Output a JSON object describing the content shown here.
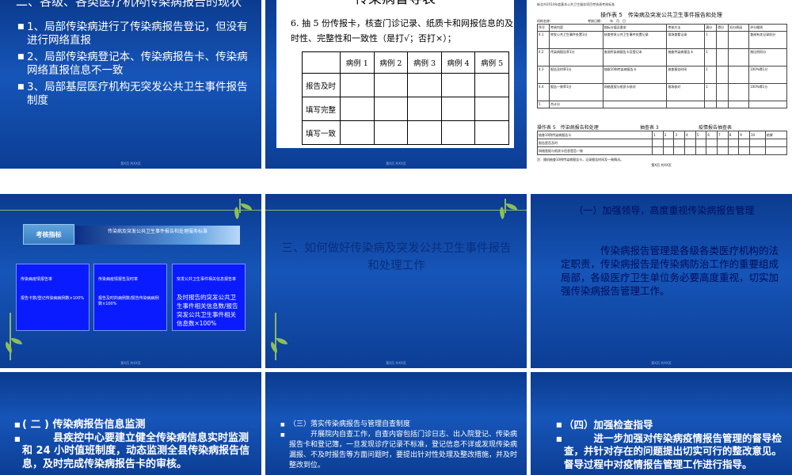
{
  "slide1": {
    "title": "二、各级、各类医疗机构传染病报告的现状",
    "bullets": [
      "1、局部传染病进行了传染病报告登记，但没有进行网络直报",
      "2、局部传染病登记本、传染病报告卡、传染病网络直报信息不一致",
      "3、局部基层医疗机构无突发公共卫生事件报告制度"
    ],
    "footer": "第X页 共XX页"
  },
  "slide2": {
    "title": "传染病督导表",
    "desc": "6. 抽 5 份传报卡，核查门诊记录、纸质卡和网报信息的及时性、完整性和一致性（是打√；否打×）；",
    "columns": [
      "",
      "病例 1",
      "病例 2",
      "病例 3",
      "病例 4",
      "病例 5"
    ],
    "rows": [
      "报告及时",
      "填写完整",
      "填写一致"
    ],
    "footer": "第X页 共XX页"
  },
  "slide3": {
    "header": "新北市2014年度基本公共卫生服务项目考核表考核标准",
    "title": "操作表 5　传染病及突发公共卫生事件报告和处理",
    "sub": "机构名称：　　　　　　　　　　　考核日期：　　年　月　日",
    "rep_header": [
      "序号",
      "考核内容",
      "指标分值及要求",
      "考核方法",
      "满分",
      "得分",
      "扣分原因",
      "评分细则"
    ],
    "rep_rows": [
      [
        "4.1",
        "突发公共卫生事件处置1分",
        "核查突发公共卫生事件处置记录",
        "现场查看记录",
        "1",
        "",
        "",
        "查阅有关记录扣分"
      ],
      [
        "4.2",
        "传染病报告率1分",
        "查阅传染病报告卡及登记本",
        "抽查传染病报告卡",
        "1",
        "",
        "",
        "按比例扣分"
      ],
      [
        "4.3",
        "报告及时率1分",
        "抽取10例传染病报告卡",
        "核查报告时间",
        "1",
        "",
        "",
        "100%得1分"
      ],
      [
        "4.4",
        "报告一致率1分",
        "网络直报与纸质卡核对",
        "现场核对",
        "1",
        "",
        "",
        "100%得1分"
      ],
      [
        "5",
        "合计分",
        "",
        "",
        "",
        "",
        "",
        ""
      ]
    ],
    "t5": "操作表 5　传染病报告和处理",
    "check_title": "抽查表 3",
    "check_title2": "疫情报告抽查表",
    "check_header": [
      "抽查10例传染病报告卡",
      "1",
      "2",
      "3",
      "4",
      "5",
      "6",
      "7",
      "8",
      "9",
      "10",
      "结果"
    ],
    "check_rows": [
      "报告是否及时",
      "网络直报与纸质卡信息是否一致"
    ],
    "note": "注：随机抽查10例传染病报告卡，记录报告时间及一致情况。",
    "page": "第X页 共XX页"
  },
  "slide4": {
    "tag": "考核指标",
    "bar": "传染病及突发公共卫生事件报告和处理服务标准",
    "boxes": [
      {
        "title": "传染病疫情报告率",
        "body": "报告卡数/登记传染病病例数×100%"
      },
      {
        "title": "传染病疫情报告及时率",
        "body": "报告及时的病例数/报告传染病病例数×100%"
      },
      {
        "title": "突发公共卫生事件相关信息报告率",
        "body": "及时报告的突发公共卫生事件相关信息数/报告突发公共卫生事件相关信息数×100%"
      }
    ],
    "footer": "第X页 共XX页"
  },
  "slide5": {
    "title": "三、如何做好传染病及突发公共卫生事件报告和处理工作",
    "footer": "第X页 共XX页"
  },
  "slide6": {
    "heading": "（一）加强领导，高度重视传染病报告管理",
    "body": "传染病报告管理是各级各类医疗机构的法定职责，传染病报告是传染病防治工作的重要组成局部，各级医疗卫生单位务必要高度重视，切实加强传染病报告管理工作。",
    "footer": "第X页 共XX页"
  },
  "slide7": {
    "heading": "( 二 ) 传染病报告信息监测",
    "body": "县疾控中心要建立健全传染病信息实时监测和 24 小时值班制度，动态监测全县传染病报告信息，及时完成传染病报告卡的审核。"
  },
  "slide8": {
    "heading": "（三）落实传染病报告与管理自查制度",
    "body": "开展院内自查工作，自查内容包括门诊日志、出入院登记、传染病报告卡和登记簿，一旦发现诊疗记录不标准，登记信息不详或发现传染病漏报、不及时报告等方面问题时，要提出针对性处理及整改措施，并及时整改到位。"
  },
  "slide9": {
    "heading": "（四）加强检查指导",
    "body": "进一步加强对传染病疫情报告管理的督导检查，并针对存在的问题提出切实可行的整改意见。督导过程中对疫情报告管理工作进行指导。"
  },
  "colors": {
    "slide_bg": "#1655b8",
    "accent_blue_box": "#0a1cff",
    "dark_text": "#0a2e7e",
    "leaf_green": "#8cc05a"
  }
}
